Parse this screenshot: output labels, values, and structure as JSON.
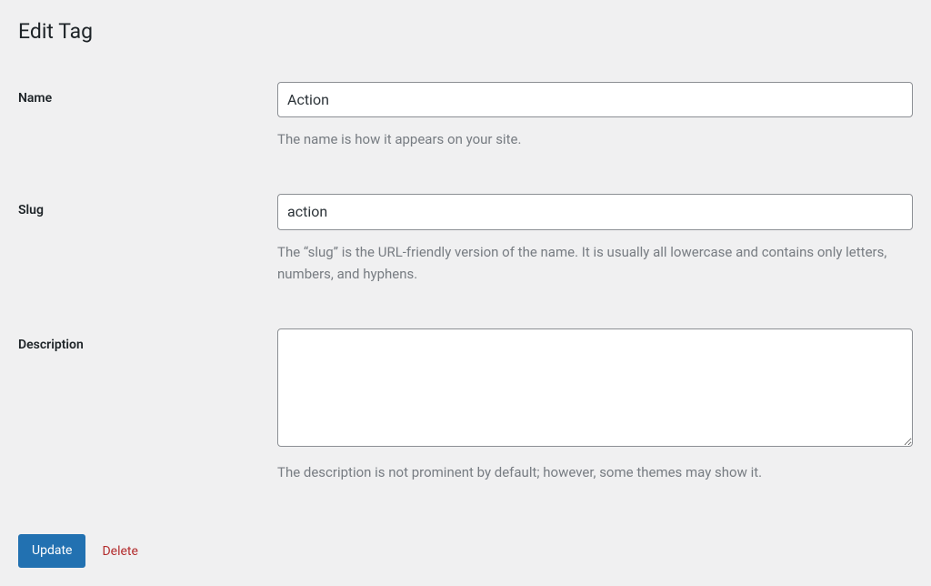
{
  "page": {
    "title": "Edit Tag"
  },
  "fields": {
    "name": {
      "label": "Name",
      "value": "Action",
      "description": "The name is how it appears on your site."
    },
    "slug": {
      "label": "Slug",
      "value": "action",
      "description": "The “slug” is the URL-friendly version of the name. It is usually all lowercase and contains only letters, numbers, and hyphens."
    },
    "description": {
      "label": "Description",
      "value": "",
      "description": "The description is not prominent by default; however, some themes may show it."
    }
  },
  "actions": {
    "update_label": "Update",
    "delete_label": "Delete"
  }
}
